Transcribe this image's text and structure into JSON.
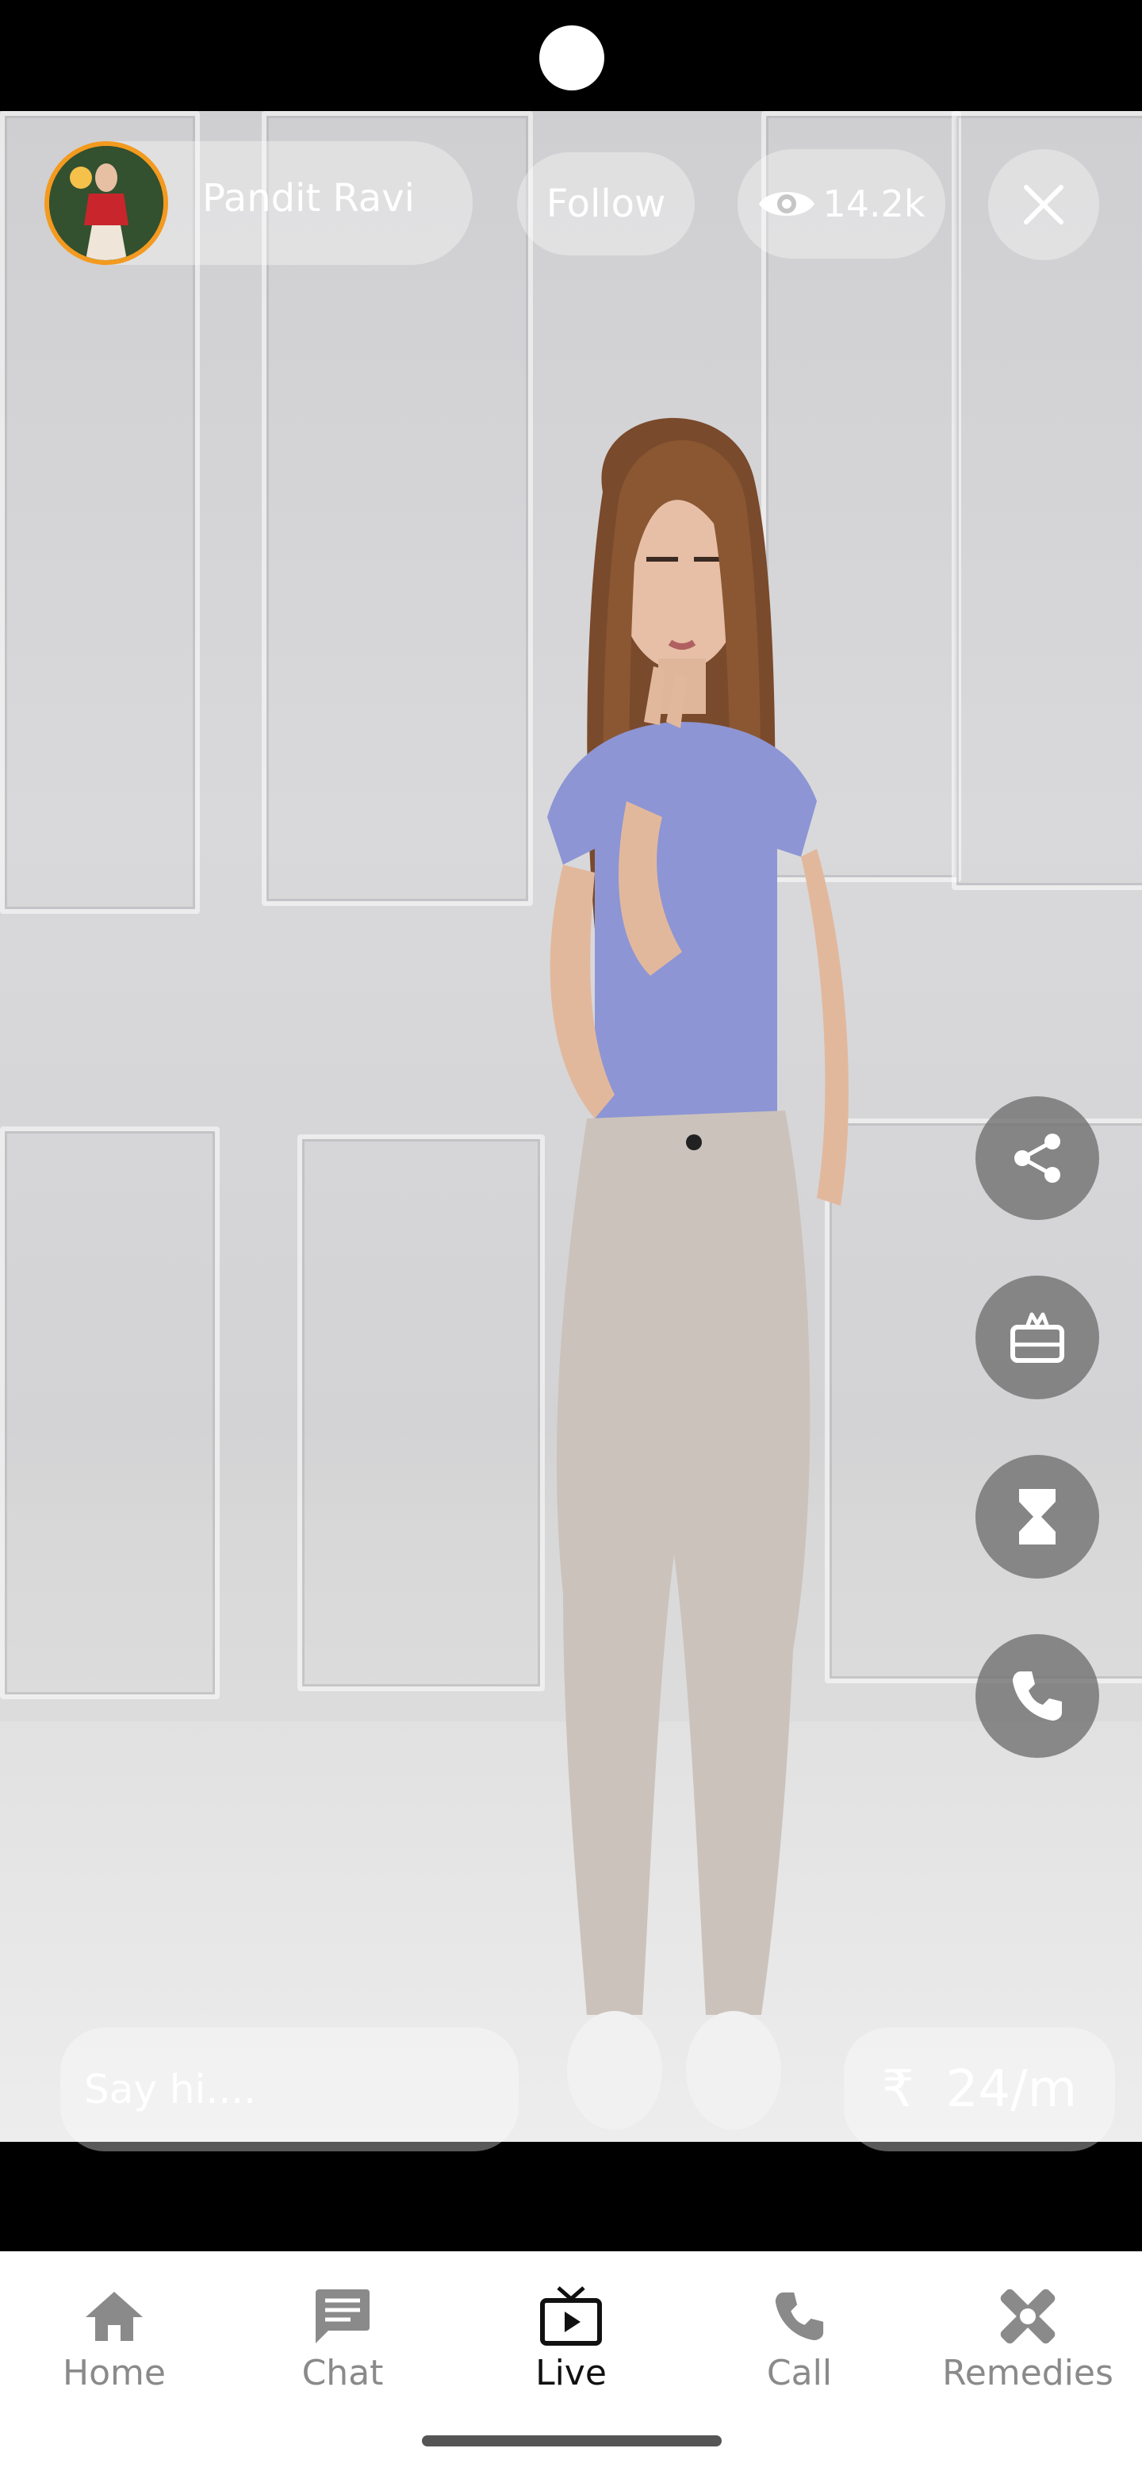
{
  "header": {
    "host_name": "Pandit Ravi",
    "follow_label": "Follow",
    "viewer_count": "14.2k"
  },
  "side_actions": [
    "share-icon",
    "gift-icon",
    "hourglass-icon",
    "phone-icon"
  ],
  "footer": {
    "message_placeholder": "Say hi....",
    "currency_symbol": "₹",
    "rate": "24/m"
  },
  "bottom_nav": {
    "items": [
      {
        "label": "Home",
        "icon": "home-icon"
      },
      {
        "label": "Chat",
        "icon": "chat-icon"
      },
      {
        "label": "Live",
        "icon": "live-tv-icon",
        "active": true
      },
      {
        "label": "Call",
        "icon": "phone-icon"
      },
      {
        "label": "Remedies",
        "icon": "bandage-icon"
      }
    ]
  },
  "colors": {
    "avatar_ring": "#f39a1f",
    "nav_active": "#111111",
    "nav_inactive": "#8a8a8a"
  }
}
